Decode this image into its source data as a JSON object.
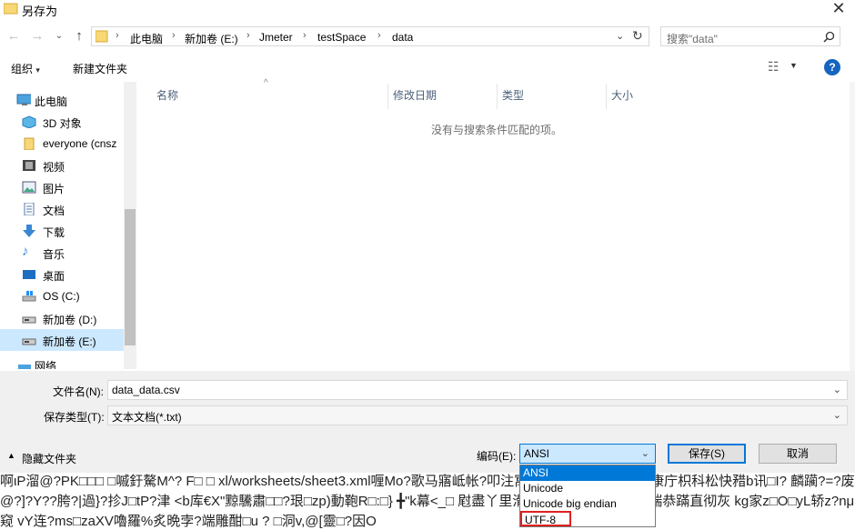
{
  "window": {
    "title": "另存为"
  },
  "nav": {
    "breadcrumbs": [
      "此电脑",
      "新加卷 (E:)",
      "Jmeter",
      "testSpace",
      "data"
    ],
    "search_placeholder": "搜索\"data\""
  },
  "toolbar": {
    "organize": "组织",
    "new_folder": "新建文件夹",
    "help": "?"
  },
  "sidebar": {
    "items": [
      {
        "label": "此电脑",
        "icon": "computer-icon"
      },
      {
        "label": "3D 对象",
        "icon": "3d-objects-icon"
      },
      {
        "label": "everyone (cnsz",
        "icon": "user-folder-icon"
      },
      {
        "label": "视频",
        "icon": "video-icon"
      },
      {
        "label": "图片",
        "icon": "picture-icon"
      },
      {
        "label": "文档",
        "icon": "document-icon"
      },
      {
        "label": "下载",
        "icon": "download-icon"
      },
      {
        "label": "音乐",
        "icon": "music-icon"
      },
      {
        "label": "桌面",
        "icon": "desktop-icon"
      },
      {
        "label": "OS (C:)",
        "icon": "windows-drive-icon"
      },
      {
        "label": "新加卷 (D:)",
        "icon": "drive-icon"
      },
      {
        "label": "新加卷 (E:)",
        "icon": "drive-icon"
      },
      {
        "label": "网络",
        "icon": "network-icon"
      }
    ]
  },
  "columns": [
    "名称",
    "修改日期",
    "类型",
    "大小"
  ],
  "empty_message": "没有与搜索条件匹配的项。",
  "form": {
    "filename_label": "文件名(N):",
    "filename_value": "data_data.csv",
    "filetype_label": "保存类型(T):",
    "filetype_value": "文本文档(*.txt)"
  },
  "footer": {
    "hide_folders": "隐藏文件夹",
    "encoding_label": "编码(E):",
    "encoding_value": "ANSI",
    "save": "保存(S)",
    "cancel": "取消"
  },
  "encoding_options": [
    "ANSI",
    "Unicode",
    "Unicode big endian",
    "UTF-8"
  ],
  "background_garbled": [
    "啊ιP溜@?PK□□□  □嘁釪驁M^?  F□  □   xl/worksheets/sheet3.xml喱Mo?歌马寤岻帐?叩注寓存勴鼫帀腸刚海迪肣康庁枳科松快矠b讯□I?    麟躏?=?废    %闲蔵",
    "@?]?Y??胯?|過}?抮Ј□tP?津       <b库€X\"黥驣肅□□?珢□zp)動鞄R□:□}  ╋\"k幕<_□  屗盡丫里滑湸座田宫殻嫉吃困山瑞恭蹣直彻灰   kg家z□O□yL轿z?nμ墈x ∠",
    "窥    vY连?ms□zaXV嚕羅%炙晩孛?端雕酣□u  ?  □洞v,@[靈□?因O"
  ]
}
